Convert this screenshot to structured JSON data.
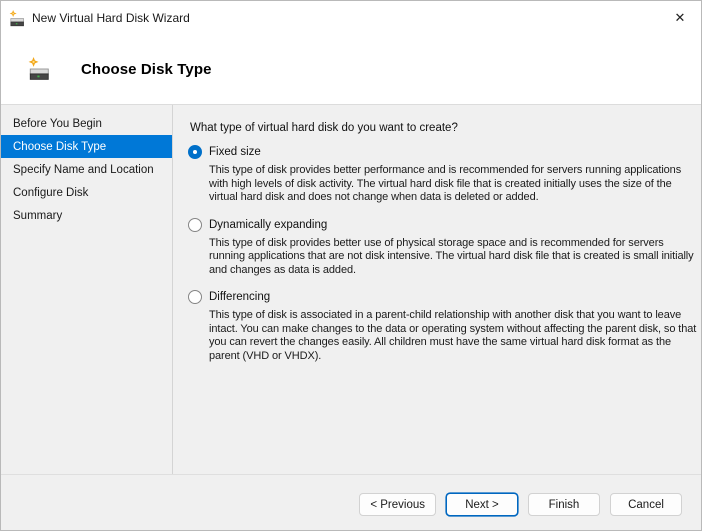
{
  "window": {
    "title": "New Virtual Hard Disk Wizard",
    "close_glyph": "✕"
  },
  "header": {
    "title": "Choose Disk Type",
    "icon": "new-virtual-hard-disk-icon"
  },
  "sidebar": {
    "items": [
      {
        "label": "Before You Begin",
        "selected": false
      },
      {
        "label": "Choose Disk Type",
        "selected": true
      },
      {
        "label": "Specify Name and Location",
        "selected": false
      },
      {
        "label": "Configure Disk",
        "selected": false
      },
      {
        "label": "Summary",
        "selected": false
      }
    ]
  },
  "main": {
    "question": "What type of virtual hard disk do you want to create?",
    "options": [
      {
        "label": "Fixed size",
        "selected": true,
        "description": "This type of disk provides better performance and is recommended for servers running applications with high levels of disk activity. The virtual hard disk file that is created initially uses the size of the virtual hard disk and does not change when data is deleted or added."
      },
      {
        "label": "Dynamically expanding",
        "selected": false,
        "description": "This type of disk provides better use of physical storage space and is recommended for servers running applications that are not disk intensive. The virtual hard disk file that is created is small initially and changes as data is added."
      },
      {
        "label": "Differencing",
        "selected": false,
        "description": "This type of disk is associated in a parent-child relationship with another disk that you want to leave intact. You can make changes to the data or operating system without affecting the parent disk, so that you can revert the changes easily. All children must have the same virtual hard disk format as the parent (VHD or VHDX)."
      }
    ]
  },
  "footer": {
    "buttons": [
      {
        "label": "< Previous",
        "default": false
      },
      {
        "label": "Next >",
        "default": true
      },
      {
        "label": "Finish",
        "default": false
      },
      {
        "label": "Cancel",
        "default": false
      }
    ]
  },
  "colors": {
    "accent": "#0078d7",
    "accent_dark": "#0067c0",
    "radio_selected": "#0070c9",
    "body_bg": "#f0f0f0",
    "divider": "#d4d4d4"
  }
}
